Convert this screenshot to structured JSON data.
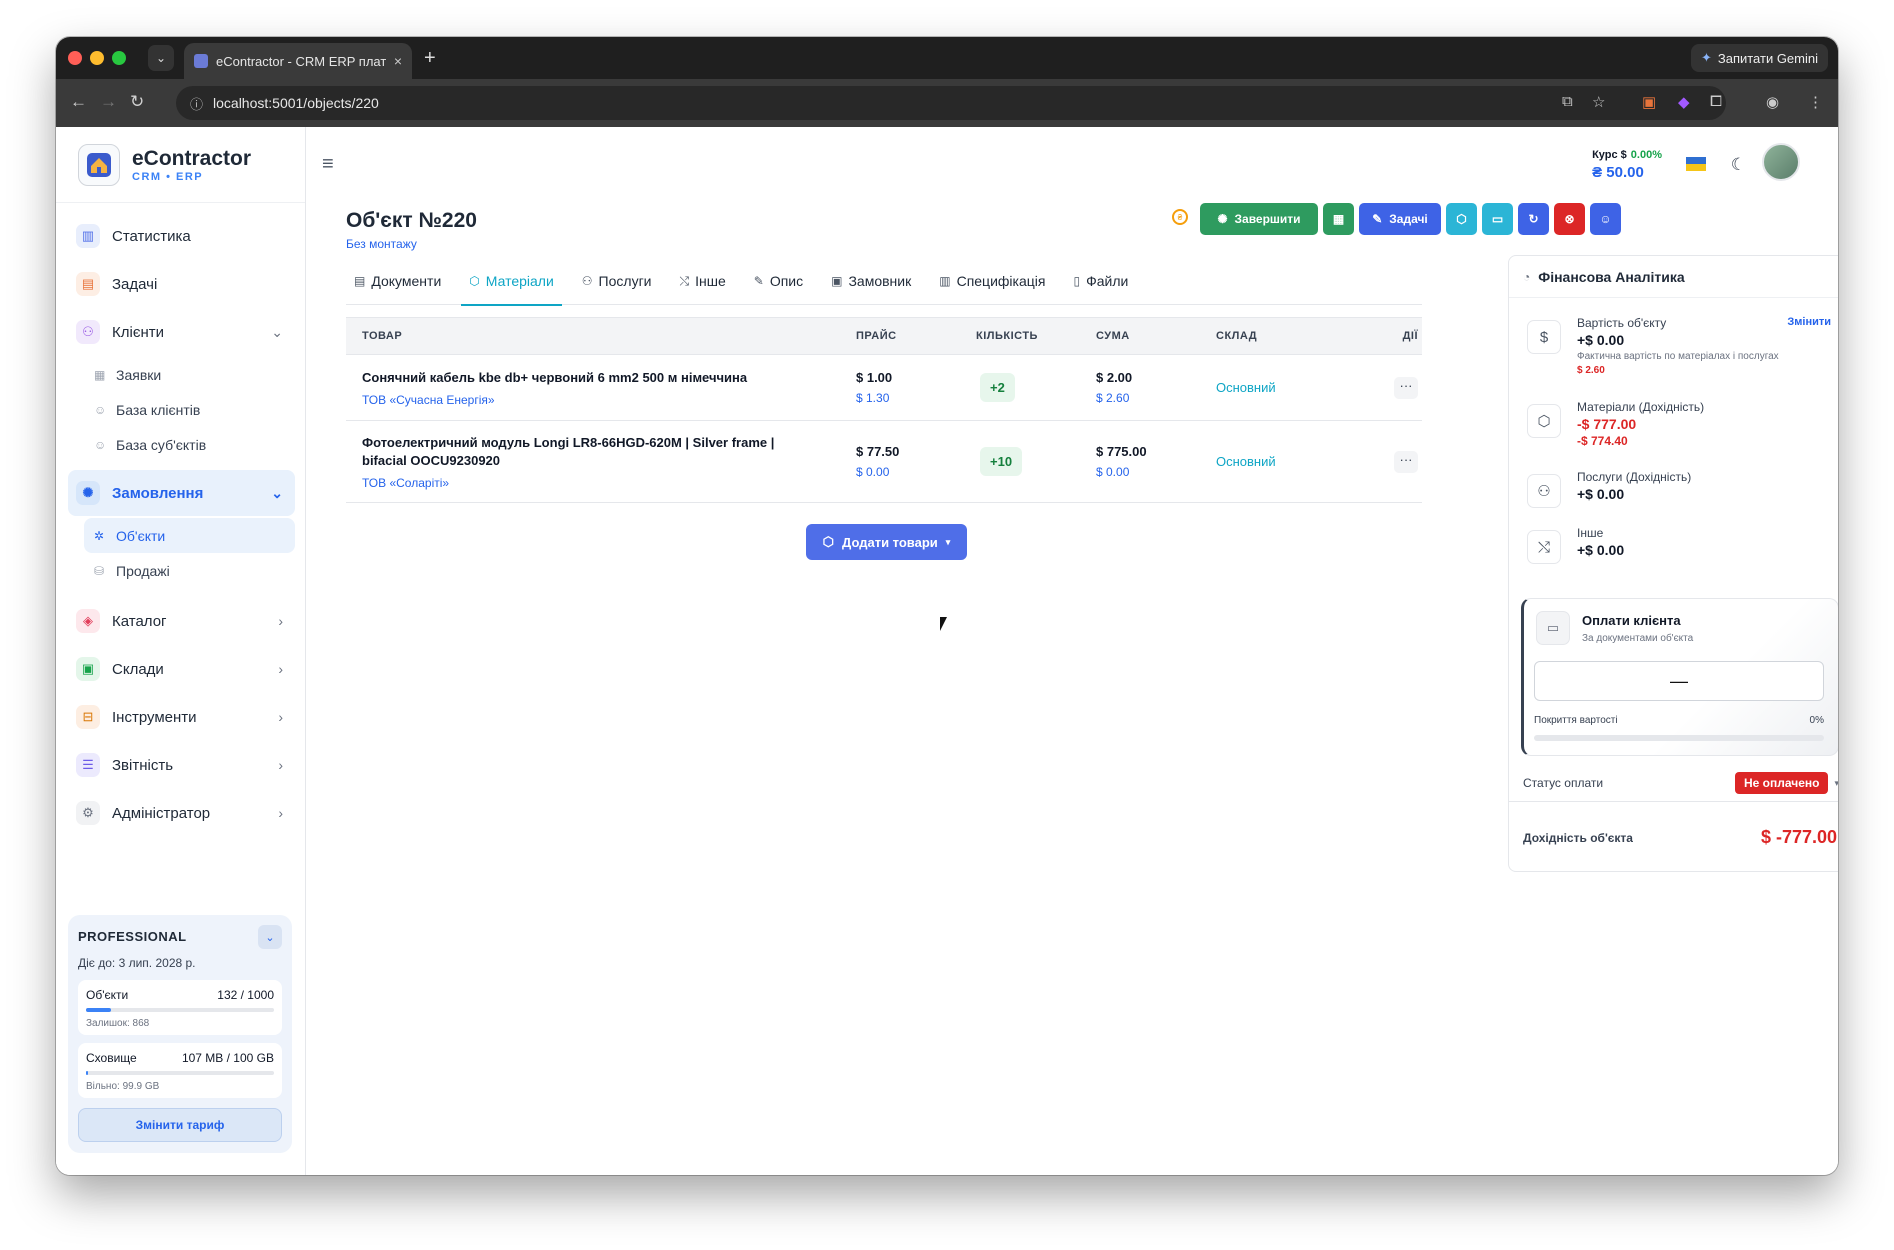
{
  "browser": {
    "tab_title": "eContractor - CRM ERP плат…",
    "url": "localhost:5001/objects/220",
    "gemini_label": "Запитати Gemini"
  },
  "brand": {
    "name": "eContractor",
    "sub": "CRM • ERP"
  },
  "sidebar": {
    "items": [
      {
        "label": "Статистика",
        "icon": "chart-icon"
      },
      {
        "label": "Задачі",
        "icon": "clipboard-icon"
      },
      {
        "label": "Клієнти",
        "icon": "users-icon"
      },
      {
        "label": "Замовлення",
        "icon": "orders-icon"
      },
      {
        "label": "Каталог",
        "icon": "box-icon"
      },
      {
        "label": "Склади",
        "icon": "warehouse-icon"
      },
      {
        "label": "Інструменти",
        "icon": "briefcase-icon"
      },
      {
        "label": "Звітність",
        "icon": "report-icon"
      },
      {
        "label": "Адміністратор",
        "icon": "gear-icon"
      }
    ],
    "clients_sub": [
      "Заявки",
      "База клієнтів",
      "База суб'єктів"
    ],
    "orders_sub": [
      "Об'єкти",
      "Продажі"
    ]
  },
  "plan": {
    "name": "PROFESSIONAL",
    "valid": "Діє до: 3 лип. 2028 р.",
    "objects_label": "Об'єкти",
    "objects_value": "132 / 1000",
    "objects_fill": 0.132,
    "objects_left": "Залишок: 868",
    "storage_label": "Сховище",
    "storage_value": "107 MB / 100 GB",
    "storage_fill": 0.001,
    "storage_free": "Вільно: 99.9 GB",
    "change_button": "Змінити тариф"
  },
  "header": {
    "rate_label": "Курс $",
    "rate_change": "0.00%",
    "rate_value": "₴ 50.00"
  },
  "page": {
    "title": "Об'єкт №220",
    "subtitle": "Без монтажу"
  },
  "actions": {
    "finish": "Завершити",
    "tasks": "Задачі"
  },
  "tabs": [
    {
      "label": "Документи",
      "icon": "document-icon"
    },
    {
      "label": "Матеріали",
      "icon": "cube-icon"
    },
    {
      "label": "Послуги",
      "icon": "person-icon"
    },
    {
      "label": "Інше",
      "icon": "shuffle-icon"
    },
    {
      "label": "Опис",
      "icon": "edit-icon"
    },
    {
      "label": "Замовник",
      "icon": "id-card-icon"
    },
    {
      "label": "Специфікація",
      "icon": "spec-icon"
    },
    {
      "label": "Файли",
      "icon": "file-icon"
    }
  ],
  "table": {
    "headers": [
      "ТОВАР",
      "ПРАЙС",
      "КІЛЬКІСТЬ",
      "СУМА",
      "СКЛАД",
      "ДІЇ"
    ],
    "rows": [
      {
        "name": "Сонячний кабель kbe db+ червоний 6 mm2 500 м німеччина",
        "vendor": "ТОВ «Сучасна Енергія»",
        "price": "$ 1.00",
        "price_sub": "$ 1.30",
        "qty": "+2",
        "sum": "$ 2.00",
        "sum_sub": "$ 2.60",
        "warehouse": "Основний"
      },
      {
        "name": "Фотоелектричний модуль Longi LR8-66HGD-620M | Silver frame | bifacial OOCU9230920",
        "vendor": "ТОВ «Соларіті»",
        "price": "$ 77.50",
        "price_sub": "$ 0.00",
        "qty": "+10",
        "sum": "$ 775.00",
        "sum_sub": "$ 0.00",
        "warehouse": "Основний"
      }
    ],
    "add_button": "Додати товари"
  },
  "finance": {
    "title": "Фінансова Аналітика",
    "cost_label": "Вартість об'єкту",
    "cost_edit": "Змінити",
    "cost_value": "+$ 0.00",
    "cost_desc": "Фактична вартість по матеріалах і послугах",
    "cost_actual": "$ 2.60",
    "materials_label": "Матеріали (Дохідність)",
    "materials_value": "-$ 777.00",
    "materials_sub": "-$ 774.40",
    "services_label": "Послуги (Дохідність)",
    "services_value": "+$ 0.00",
    "other_label": "Інше",
    "other_value": "+$ 0.00",
    "payments_title": "Оплати клієнта",
    "payments_sub": "За документами об'єкта",
    "payments_value": "—",
    "coverage_label": "Покриття вартості",
    "coverage_value": "0%",
    "status_label": "Статус оплати",
    "status_value": "Не оплачено",
    "profit_label": "Дохідність об'єкта",
    "profit_value": "$ -777.00"
  },
  "colors": {
    "accent": "#0ea5c5",
    "primary": "#4f6ee8",
    "success": "#16a34a",
    "danger": "#dc2626"
  }
}
